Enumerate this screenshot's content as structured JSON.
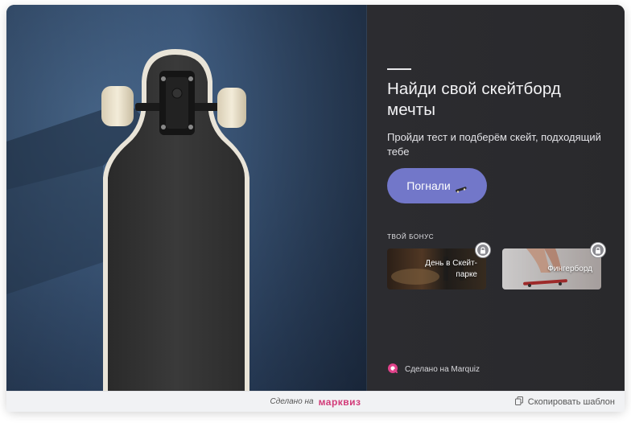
{
  "hero": {
    "title": "Найди свой скейтборд мечты",
    "subtitle": "Пройди тест и подберём скейт, подходящий тебе",
    "cta_label": "Погнали",
    "cta_icon": "skateboard-icon"
  },
  "bonus": {
    "label": "твой бонус",
    "items": [
      {
        "label": "День в Скейт-парке",
        "icon": "lock-icon"
      },
      {
        "label": "Фингерборд",
        "icon": "lock-icon"
      }
    ]
  },
  "made_with": {
    "label": "Сделано на Marquiz",
    "icon": "marquiz-logo-icon"
  },
  "footer": {
    "made_label": "Сделано на",
    "brand": "марквиз",
    "copy_label": "Скопировать шаблон",
    "copy_icon": "copy-icon"
  },
  "colors": {
    "accent": "#7277c9",
    "panel_bg": "#2b2b2e",
    "brand": "#d23a78"
  }
}
